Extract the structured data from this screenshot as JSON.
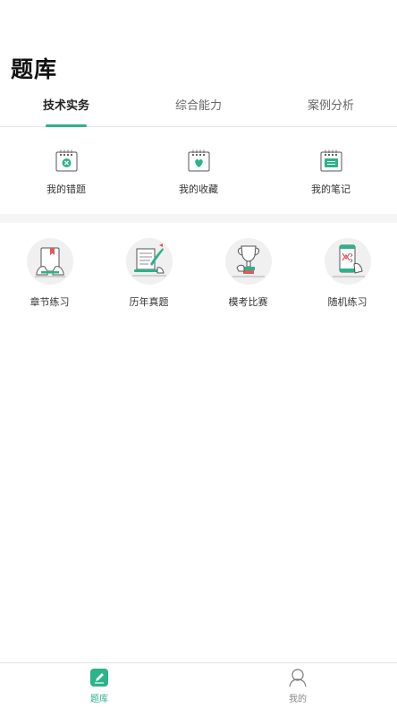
{
  "header": {
    "title": "题库"
  },
  "tabs": [
    {
      "label": "技术实务",
      "active": true
    },
    {
      "label": "综合能力",
      "active": false
    },
    {
      "label": "案例分析",
      "active": false
    }
  ],
  "quick_actions": [
    {
      "label": "我的错题",
      "icon": "wrong-questions-calendar-icon"
    },
    {
      "label": "我的收藏",
      "icon": "favorites-heart-calendar-icon"
    },
    {
      "label": "我的笔记",
      "icon": "notes-calendar-icon"
    }
  ],
  "practice": [
    {
      "label": "章节练习",
      "icon": "chapter-practice-book-icon"
    },
    {
      "label": "历年真题",
      "icon": "past-papers-scroll-icon"
    },
    {
      "label": "模考比赛",
      "icon": "mock-exam-trophy-icon"
    },
    {
      "label": "随机练习",
      "icon": "random-practice-phone-icon"
    }
  ],
  "bottom_nav": [
    {
      "label": "题库",
      "icon": "question-bank-pencil-icon",
      "active": true
    },
    {
      "label": "我的",
      "icon": "profile-person-icon",
      "active": false
    }
  ],
  "colors": {
    "accent": "#2bb38a",
    "divider": "#f5f5f5",
    "text": "#222222"
  }
}
